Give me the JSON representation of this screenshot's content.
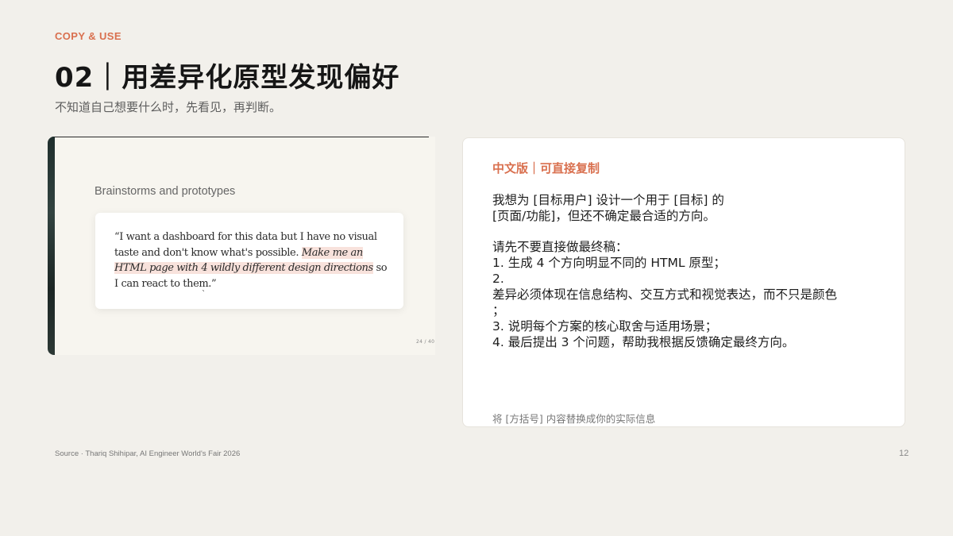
{
  "header": {
    "eyebrow": "COPY & USE",
    "title": "02｜用差异化原型发现偏好",
    "subtitle": "不知道自己想要什么时，先看见，再判断。"
  },
  "screenshot": {
    "heading": "Brainstorms and prototypes",
    "quote_plain": "“I want a dashboard for this data but I have no visual taste and don't know what's possible. ",
    "quote_emphasis": "Make me an HTML page with 4 wildly different design directions",
    "quote_end": " so I can react to them.”",
    "tick": "`",
    "page_indicator": "24 / 40"
  },
  "prompt_card": {
    "label": "中文版｜可直接复制",
    "lines_a": [
      "我想为 [目标用户] 设计一个用于 [目标] 的",
      "[页面/功能]，但还不确定最合适的方向。"
    ],
    "lines_b": [
      "请先不要直接做最终稿：",
      "1. 生成 4 个方向明显不同的 HTML 原型；",
      "2.",
      "差异必须体现在信息结构、交互方式和视觉表达，而不只是颜色",
      "；",
      "3. 说明每个方案的核心取舍与适用场景；",
      "4. 最后提出 3 个问题，帮助我根据反馈确定最终方向。"
    ],
    "note": "将 [方括号] 内容替换成你的实际信息"
  },
  "footer": {
    "source": "Source · Thariq Shihipar, AI Engineer World's Fair 2026",
    "page_number": "12"
  },
  "colors": {
    "accent": "#d9704f",
    "background": "#f2f0eb",
    "highlight": "#f8e2dc"
  }
}
